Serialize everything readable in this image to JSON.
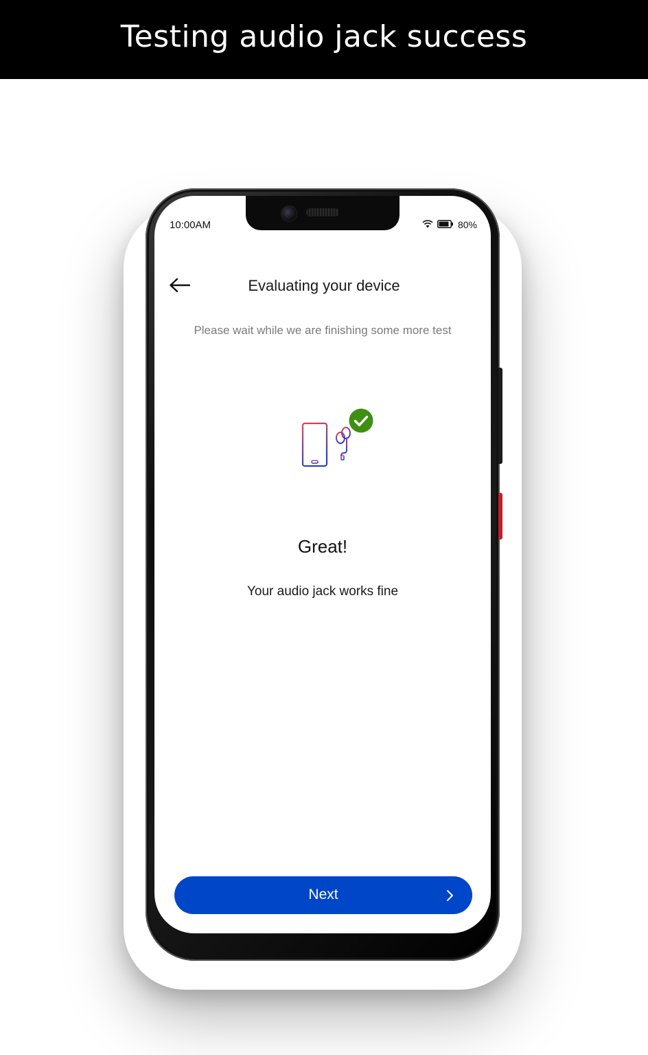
{
  "banner": {
    "title": "Testing audio jack success"
  },
  "status_bar": {
    "time": "10:00AM",
    "battery": "80%",
    "icons": [
      "wifi-icon",
      "battery-icon"
    ]
  },
  "header": {
    "back_icon": "back-arrow-icon",
    "title": "Evaluating your device"
  },
  "subtitle": "Please wait while we are finishing some more test",
  "illustration": {
    "icons": [
      "phone-icon",
      "earphones-icon",
      "check-badge-icon"
    ]
  },
  "result": {
    "heading": "Great!",
    "message": "Your audio jack works fine"
  },
  "next_button": {
    "label": "Next",
    "icon": "chevron-right-icon"
  },
  "colors": {
    "primary": "#0046c8",
    "success": "#3f8f12",
    "icon_gradient_start": "#e8404e",
    "icon_gradient_end": "#2c3fd0",
    "banner_bg": "#000000"
  }
}
